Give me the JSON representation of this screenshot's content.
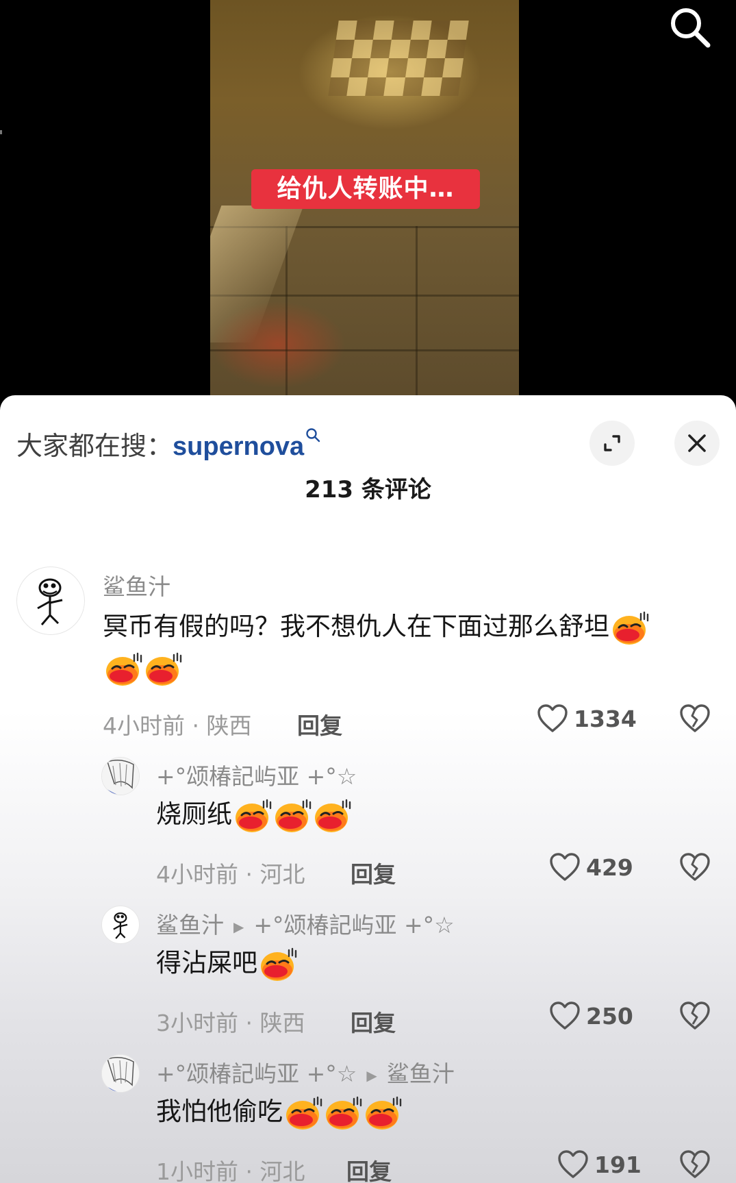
{
  "video": {
    "caption": "给仇人转账中…"
  },
  "icons": {
    "search": "search-icon",
    "expand": "expand-icon",
    "close": "close-icon",
    "like": "heart-icon",
    "dislike": "broken-heart-icon",
    "emoji": "smug-emoji"
  },
  "sheet": {
    "trending_prefix": "大家都在搜：",
    "trending_term": "supernova",
    "comment_count_title": "213 条评论"
  },
  "comments": [
    {
      "user": "鲨鱼汁",
      "text": "冥币有假的吗？我不想仇人在下面过那么舒坦",
      "emoji_count": 3,
      "meta": "4小时前 · 陕西",
      "reply_label": "回复",
      "likes": "1334"
    },
    {
      "user": "+°颂椿記屿亚 +°☆",
      "text": "烧厕纸",
      "emoji_count": 3,
      "meta": "4小时前 · 河北",
      "reply_label": "回复",
      "likes": "429"
    },
    {
      "user": "鲨鱼汁",
      "reply_to": "+°颂椿記屿亚 +°☆",
      "text": "得沾屎吧",
      "emoji_count": 1,
      "meta": "3小时前 · 陕西",
      "reply_label": "回复",
      "likes": "250"
    },
    {
      "user": "+°颂椿記屿亚 +°☆",
      "reply_to": "鲨鱼汁",
      "text": "我怕他偷吃",
      "emoji_count": 3,
      "meta": "1小时前 · 河北",
      "reply_label": "回复",
      "likes": "191"
    }
  ],
  "colors": {
    "caption_bg": "#e8323e",
    "trending_link": "#1f4e9c",
    "username": "#8a8a8a",
    "body_text": "#161616"
  }
}
